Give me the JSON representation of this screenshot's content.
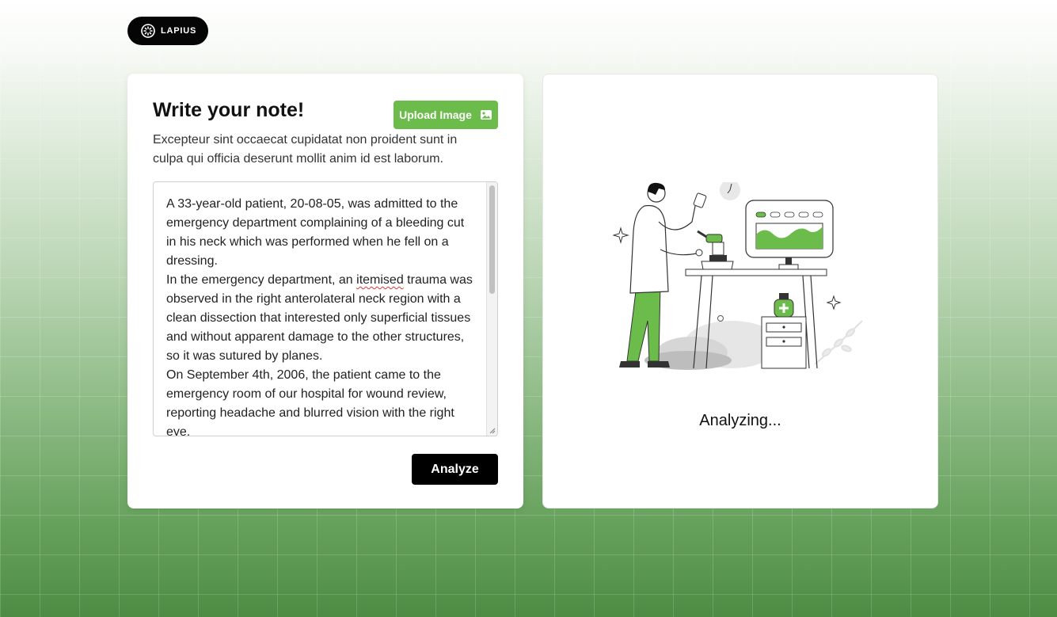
{
  "brand": {
    "name": "LAPIUS",
    "icon": "lapius-logo-icon"
  },
  "editor": {
    "title": "Write your note!",
    "upload_label": "Upload Image",
    "upload_icon": "image-icon",
    "description": "Excepteur sint occaecat cupidatat non proident sunt in culpa qui officia deserunt mollit anim id est laborum.",
    "note_lines": [
      "A 33-year-old patient, 20-08-05, was admitted to the emergency department complaining of a bleeding cut in his neck which was performed when he fell on a dressing.",
      "In the emergency department, an ",
      "itemised",
      " trauma was observed in the right anterolateral neck region with a clean dissection that interested only superficial tissues and without apparent damage to the other structures, so it was sutured by planes.",
      "On September 4th, 2006, the patient came to the emergency room of our hospital for wound review, reporting headache and blurred vision with the right eye."
    ],
    "analyze_label": "Analyze"
  },
  "result": {
    "illustration": "scientist-microscope-illustration",
    "status": "Analyzing..."
  },
  "colors": {
    "accent": "#6cbc4b",
    "dark": "#000000",
    "background_bottom": "#4e8c43"
  }
}
